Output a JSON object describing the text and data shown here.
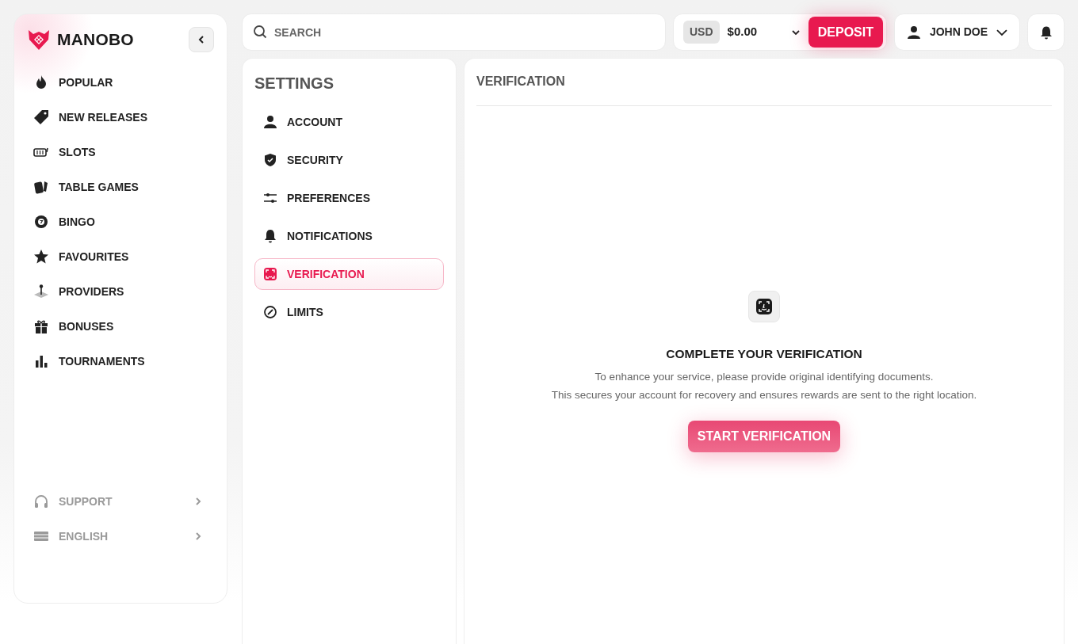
{
  "brand": {
    "name": "MANOBO"
  },
  "sidebar": {
    "items": [
      {
        "label": "POPULAR"
      },
      {
        "label": "NEW RELEASES"
      },
      {
        "label": "SLOTS"
      },
      {
        "label": "TABLE GAMES"
      },
      {
        "label": "BINGO"
      },
      {
        "label": "FAVOURITES"
      },
      {
        "label": "PROVIDERS"
      },
      {
        "label": "BONUSES"
      },
      {
        "label": "TOURNAMENTS"
      }
    ],
    "footer_items": [
      {
        "label": "SUPPORT"
      },
      {
        "label": "ENGLISH"
      }
    ]
  },
  "search": {
    "placeholder": "SEARCH"
  },
  "wallet": {
    "currency": "USD",
    "balance": "$0.00",
    "deposit_button": "DEPOSIT"
  },
  "user": {
    "name": "JOHN DOE"
  },
  "settings": {
    "title": "SETTINGS",
    "items": [
      {
        "label": "ACCOUNT",
        "selected": false
      },
      {
        "label": "SECURITY",
        "selected": false
      },
      {
        "label": "PREFERENCES",
        "selected": false
      },
      {
        "label": "NOTIFICATIONS",
        "selected": false
      },
      {
        "label": "VERIFICATION",
        "selected": true
      },
      {
        "label": "LIMITS",
        "selected": false
      }
    ]
  },
  "panel": {
    "title": "VERIFICATION",
    "heading": "COMPLETE YOUR VERIFICATION",
    "lines": [
      "To enhance your service, please provide original identifying documents.",
      "This secures your account for recovery and ensures rewards are sent to the right location."
    ],
    "button": "START VERIFICATION"
  }
}
